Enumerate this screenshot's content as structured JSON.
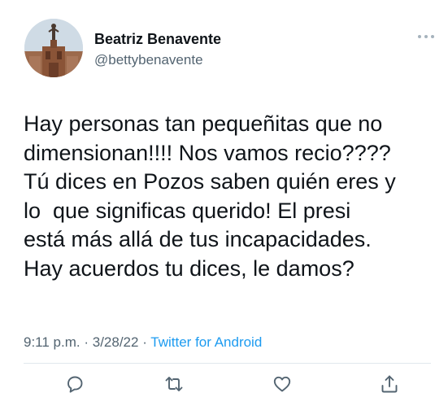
{
  "author": {
    "display_name": "Beatriz Benavente",
    "handle": "@bettybenavente"
  },
  "tweet": {
    "lines": [
      "Hay personas tan pequeñitas que no",
      "dimensionan!!!! Nos vamos recio????",
      "Tú dices en Pozos saben quién eres y",
      "lo  que significas querido! El presi",
      "está más allá de tus incapacidades.",
      "Hay acuerdos tu dices, le damos?"
    ]
  },
  "meta": {
    "time": "9:11 p.m.",
    "separator": " · ",
    "date": "3/28/22",
    "source": "Twitter for Android"
  },
  "actions": {
    "reply_icon": "reply-icon",
    "retweet_icon": "retweet-icon",
    "like_icon": "like-icon",
    "share_icon": "share-icon"
  },
  "colors": {
    "text": "#0f1419",
    "secondary": "#536471",
    "link": "#1d9bf0",
    "divider": "#e1e8ed"
  }
}
